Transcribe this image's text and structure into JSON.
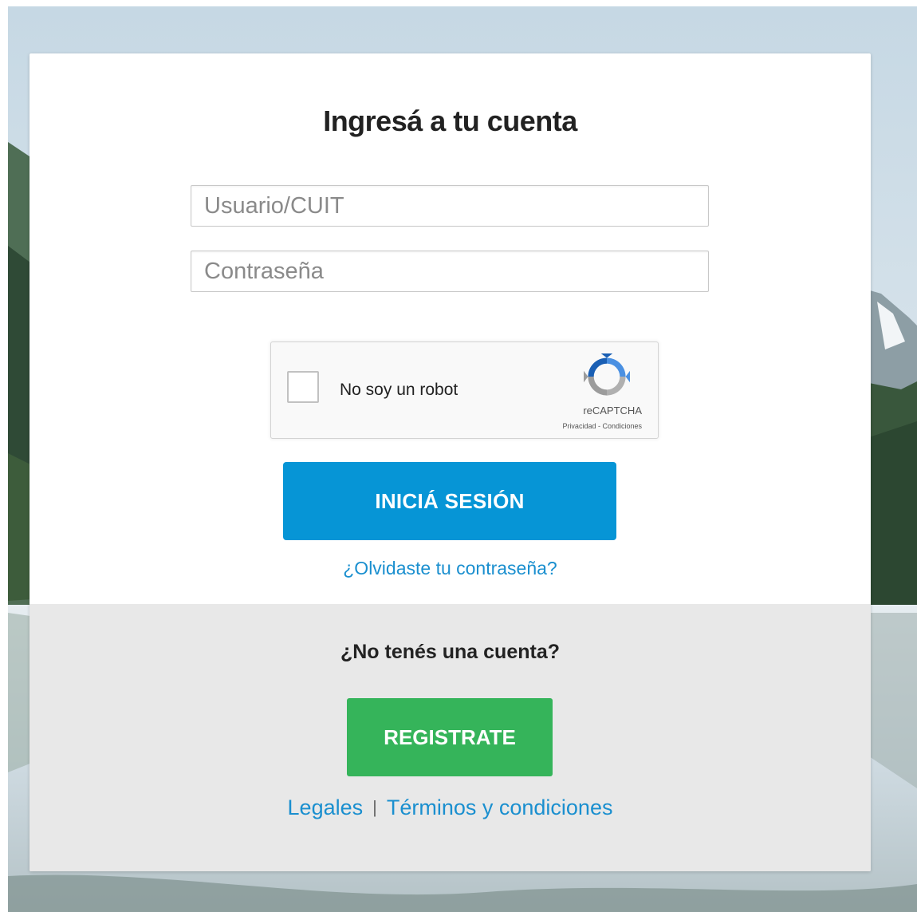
{
  "page": {
    "title": "Ingresá a tu cuenta"
  },
  "login_form": {
    "username_placeholder": "Usuario/CUIT",
    "username_value": "",
    "password_placeholder": "Contraseña",
    "password_value": "",
    "submit_label": "INICIÁ SESIÓN",
    "forgot_password_label": "¿Olvidaste tu contraseña?"
  },
  "captcha": {
    "label": "No soy un robot",
    "checked": false,
    "brand": "reCAPTCHA",
    "privacy_label": "Privacidad",
    "separator": " - ",
    "terms_label": "Condiciones",
    "icon": "recaptcha-logo-icon"
  },
  "register": {
    "prompt": "¿No tenés una cuenta?",
    "button_label": "REGISTRATE"
  },
  "footer": {
    "legal_label": "Legales",
    "separator": "|",
    "terms_label": "Términos y condiciones"
  },
  "colors": {
    "primary_button": "#0695d6",
    "register_button": "#35b45a",
    "link": "#1a8fcf",
    "footer_background": "#e8e8e8",
    "title_text": "#222222"
  }
}
